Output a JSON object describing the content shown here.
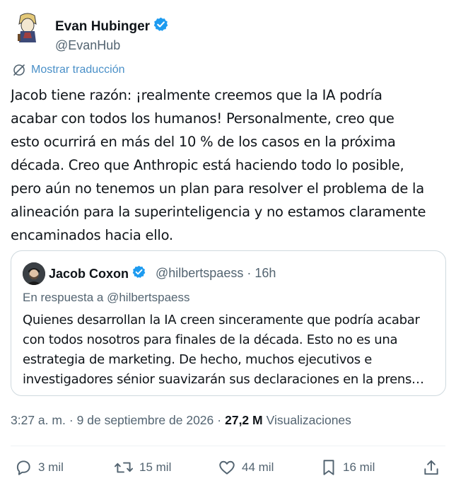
{
  "author": {
    "name": "Evan Hubinger",
    "handle": "@EvanHub"
  },
  "translate_label": "Mostrar traducción",
  "tweet_lines": [
    "Jacob tiene razón: ¡realmente creemos que la IA podría",
    "acabar con todos los humanos! Personalmente, creo que",
    "esto ocurrirá en más del 10 % de los casos en la próxima",
    "década. Creo que Anthropic está haciendo todo lo posible,",
    "pero aún no tenemos un plan para resolver el problema de la",
    "alineación para la superinteligencia y no estamos claramente",
    "encaminados hacia ello."
  ],
  "quote": {
    "name": "Jacob Coxon",
    "handle_time": "@hilbertspaess · 16h",
    "reply_to": "En respuesta a @hilbertspaess",
    "lines": [
      "Quienes desarrollan la IA creen sinceramente que podría acabar",
      "con todos nosotros para finales de la década. Esto no es una",
      "estrategia de marketing. De hecho, muchos ejecutivos e",
      "investigadores sénior suavizarán sus declaraciones en la prens…"
    ]
  },
  "meta": {
    "time": "3:27 a. m.",
    "date": "9 de septiembre de 2026",
    "views_count": "27,2 M",
    "views_label": "Visualizaciones"
  },
  "actions": {
    "replies": "3 mil",
    "reposts": "15 mil",
    "likes": "44 mil",
    "bookmarks": "16 mil"
  },
  "colors": {
    "verified": "#1d9bf0",
    "link": "#4a90c8",
    "muted": "#536471",
    "text": "#0f1419",
    "border": "#cfd9de"
  },
  "icons": [
    "verified-badge-icon",
    "translate-icon",
    "reply-icon",
    "repost-icon",
    "like-icon",
    "bookmark-icon",
    "share-icon"
  ]
}
